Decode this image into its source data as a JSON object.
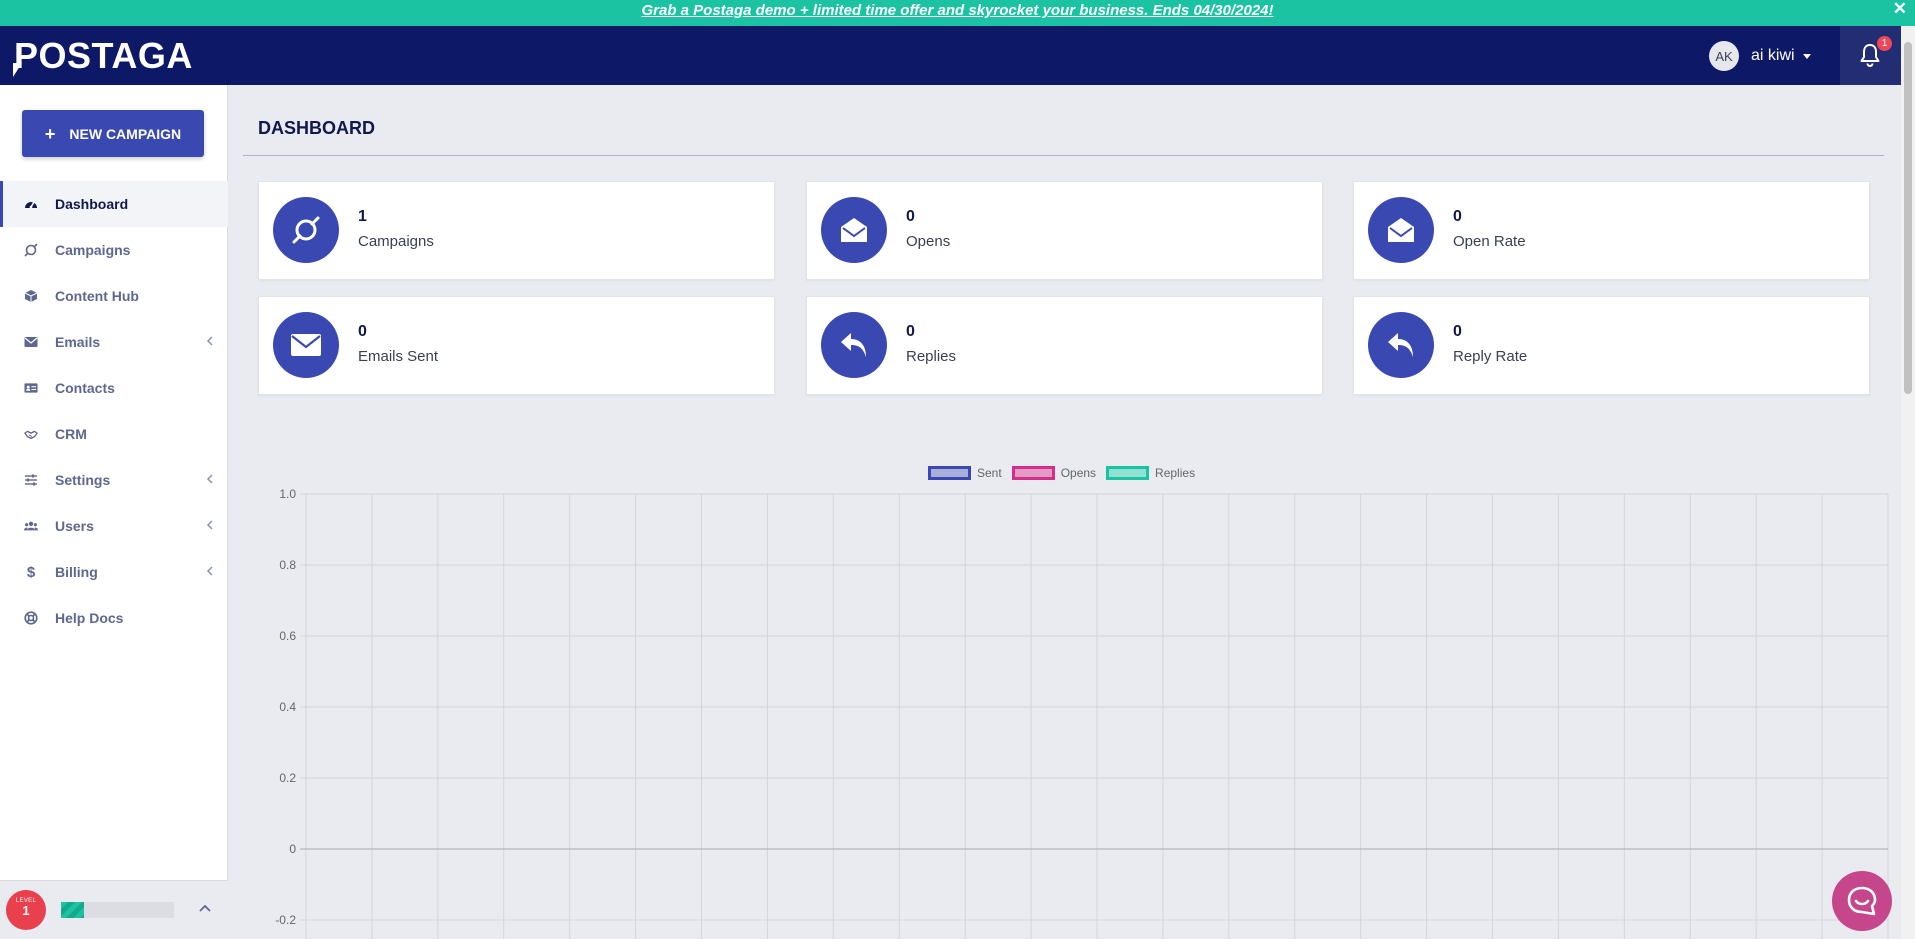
{
  "promo_banner": {
    "text": "Grab a Postaga demo + limited time offer and skyrocket your business. Ends 04/30/2024!",
    "close_label": "✕"
  },
  "header": {
    "logo_text": "POSTAGA",
    "user": {
      "initials": "AK",
      "name": "ai kiwi"
    },
    "notifications": {
      "count": "1"
    }
  },
  "sidebar": {
    "new_campaign_label": "NEW CAMPAIGN",
    "items": [
      {
        "label": "Dashboard",
        "icon": "dashboard-icon",
        "active": true
      },
      {
        "label": "Campaigns",
        "icon": "campaigns-icon"
      },
      {
        "label": "Content Hub",
        "icon": "cube-icon"
      },
      {
        "label": "Emails",
        "icon": "envelope-icon",
        "expandable": true
      },
      {
        "label": "Contacts",
        "icon": "contact-card-icon"
      },
      {
        "label": "CRM",
        "icon": "handshake-icon"
      },
      {
        "label": "Settings",
        "icon": "sliders-icon",
        "expandable": true
      },
      {
        "label": "Users",
        "icon": "users-icon",
        "expandable": true
      },
      {
        "label": "Billing",
        "icon": "dollar-icon",
        "expandable": true
      },
      {
        "label": "Help Docs",
        "icon": "lifebuoy-icon"
      }
    ],
    "footer": {
      "level_text": "LEVEL",
      "level_value": "1",
      "level_progress": 0.2
    }
  },
  "main": {
    "page_title": "DASHBOARD",
    "stats": [
      {
        "value": "1",
        "label": "Campaigns",
        "icon": "campaigns-icon"
      },
      {
        "value": "0",
        "label": "Opens",
        "icon": "envelope-open-icon"
      },
      {
        "value": "0",
        "label": "Open Rate",
        "icon": "envelope-open-icon"
      },
      {
        "value": "0",
        "label": "Emails Sent",
        "icon": "envelope-icon"
      },
      {
        "value": "0",
        "label": "Replies",
        "icon": "reply-icon"
      },
      {
        "value": "0",
        "label": "Reply Rate",
        "icon": "reply-icon"
      }
    ]
  },
  "colors": {
    "accent": "#3a49b2",
    "navbar": "#0d1867",
    "banner": "#1cc3a3",
    "chat": "#c5468b"
  },
  "chart_data": {
    "type": "line",
    "title": "",
    "xlabel": "",
    "ylabel": "",
    "ylim": [
      -0.2,
      1.0
    ],
    "y_ticks": [
      "1.0",
      "0.8",
      "0.6",
      "0.4",
      "0.2",
      "0",
      "-0.2"
    ],
    "x": [],
    "x_gridlines": 24,
    "grid": true,
    "legend_position": "top-center",
    "series": [
      {
        "name": "Sent",
        "values": [],
        "color": "#3a49b2",
        "fill": "#a9afdc"
      },
      {
        "name": "Opens",
        "values": [],
        "color": "#d42e8c",
        "fill": "#e59ac5"
      },
      {
        "name": "Replies",
        "values": [],
        "color": "#1cc3a3",
        "fill": "#8fe1d1"
      }
    ]
  }
}
